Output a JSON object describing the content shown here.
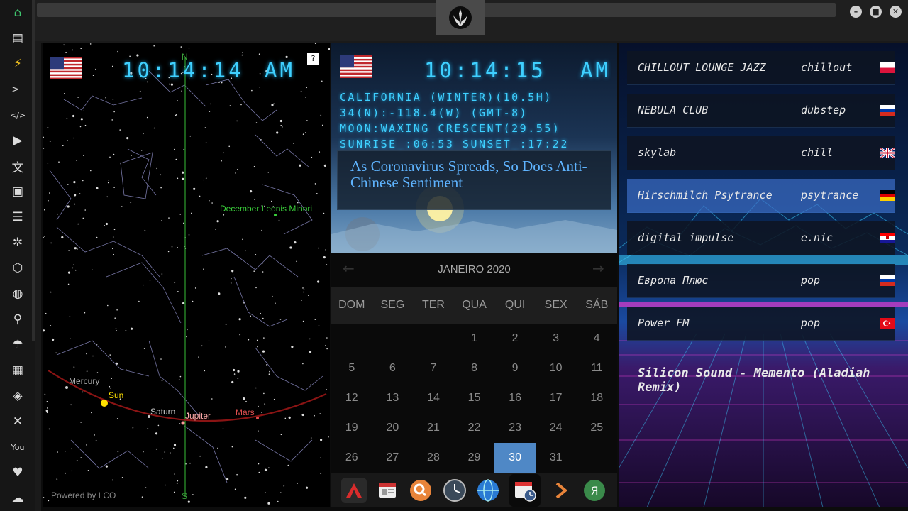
{
  "sidebar": {
    "items": [
      {
        "name": "home-icon",
        "glyph": "⌂"
      },
      {
        "name": "document-icon",
        "glyph": "▤"
      },
      {
        "name": "lightning-icon",
        "glyph": "⚡"
      },
      {
        "name": "terminal-icon",
        "glyph": ">_"
      },
      {
        "name": "code-icon",
        "glyph": "</>"
      },
      {
        "name": "play-icon",
        "glyph": "▶"
      },
      {
        "name": "translate-icon",
        "glyph": "文"
      },
      {
        "name": "image-icon",
        "glyph": "▣"
      },
      {
        "name": "news-icon",
        "glyph": "☰"
      },
      {
        "name": "aperture-icon",
        "glyph": "✲"
      },
      {
        "name": "hexagon-icon",
        "glyph": "⬡"
      },
      {
        "name": "globe-icon",
        "glyph": "◍"
      },
      {
        "name": "search-icon",
        "glyph": "⚲"
      },
      {
        "name": "umbrella-icon",
        "glyph": "☂"
      },
      {
        "name": "contact-icon",
        "glyph": "▦"
      },
      {
        "name": "diamond-icon",
        "glyph": "◈"
      },
      {
        "name": "fullscreen-icon",
        "glyph": "✕"
      },
      {
        "name": "youtube-icon",
        "glyph": "You"
      },
      {
        "name": "heart-icon",
        "glyph": "♥"
      },
      {
        "name": "cloud-icon",
        "glyph": "☁"
      }
    ]
  },
  "window": {
    "minimize": "–",
    "maximize": "■",
    "close": "✕"
  },
  "skymap": {
    "time": "10:14:14",
    "ampm": "AM",
    "help": "?",
    "north": "N",
    "south": "S",
    "meteor_label": "December Leonis Minori",
    "planets": [
      "Mercury",
      "Sun",
      "Saturn",
      "Jupiter",
      "Mars"
    ],
    "credit": "Powered by LCO"
  },
  "info": {
    "time": "10:14:15",
    "ampm": "AM",
    "lines": [
      "CALIFORNIA (WINTER)(10.5H)",
      "34(N):-118.4(W) (GMT-8)",
      "MOON:WAXING CRESCENT(29.55)",
      "SUNRISE_:06:53 SUNSET_:17:22"
    ],
    "headline": "As Coronavirus Spreads, So Does Anti-Chinese Sentiment"
  },
  "calendar": {
    "title": "JANEIRO 2020",
    "prev": "←",
    "next": "→",
    "daynames": [
      "DOM",
      "SEG",
      "TER",
      "QUA",
      "QUI",
      "SEX",
      "SÁB"
    ],
    "weeks": [
      [
        "",
        "",
        "",
        "1",
        "2",
        "3",
        "4"
      ],
      [
        "5",
        "6",
        "7",
        "8",
        "9",
        "10",
        "11"
      ],
      [
        "12",
        "13",
        "14",
        "15",
        "16",
        "17",
        "18"
      ],
      [
        "19",
        "20",
        "21",
        "22",
        "23",
        "24",
        "25"
      ],
      [
        "26",
        "27",
        "28",
        "29",
        "30",
        "31",
        ""
      ]
    ],
    "today": "30"
  },
  "dock": [
    "app-launcher-icon",
    "calendar-list-icon",
    "search-app-icon",
    "clock-icon",
    "web-browser-icon",
    "calendar-clock-icon",
    "forward-icon",
    "yandex-icon"
  ],
  "radio": {
    "stations": [
      {
        "name": "CHILLOUT LOUNGE JAZZ",
        "genre": "chillout",
        "flag": "poland"
      },
      {
        "name": "NEBULA CLUB",
        "genre": "dubstep",
        "flag": "russia"
      },
      {
        "name": "skylab",
        "genre": "chill",
        "flag": "uk"
      },
      {
        "name": "Hirschmilch Psytrance",
        "genre": "psytrance",
        "flag": "germany"
      },
      {
        "name": "digital impulse",
        "genre": "e.nic",
        "flag": "croatia"
      },
      {
        "name": "Европа Плюс",
        "genre": "pop",
        "flag": "russia"
      },
      {
        "name": "Power FM",
        "genre": "pop",
        "flag": "turkey"
      }
    ],
    "active_index": 3,
    "now_playing": "Silicon Sound - Memento (Aladiah Remix)"
  },
  "colors": {
    "accent": "#3fd0ff",
    "today": "#4f88c6",
    "active_station": "#3c6ec8"
  }
}
